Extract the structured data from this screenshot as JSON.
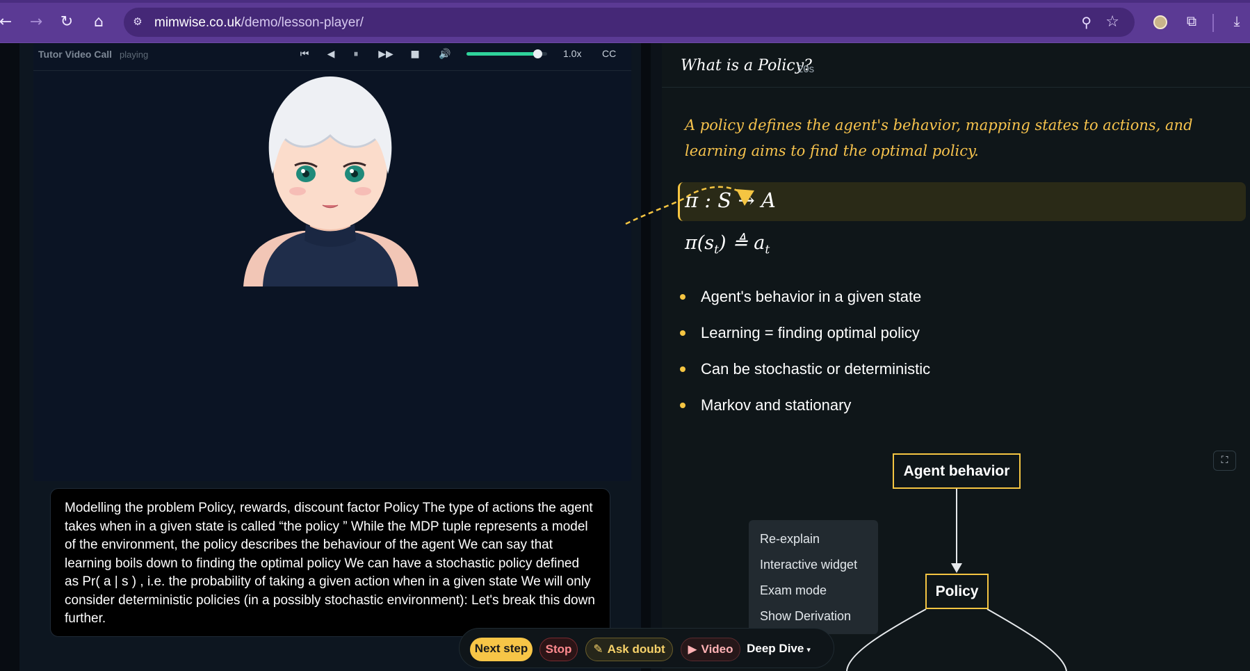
{
  "browser": {
    "url_host": "mimwise.co.uk",
    "url_path": "/demo/lesson-player/"
  },
  "video": {
    "title": "Tutor Video Call",
    "status": "playing",
    "speed": "1.0x",
    "cc_label": "CC",
    "volume_fraction": 0.88
  },
  "transcript": {
    "text": "Modelling the problem Policy, rewards, discount factor Policy The type of actions the agent takes when in a given state is called “the policy ” While the MDP tuple represents a model of the environment, the policy describes the behaviour of the agent We can say that learning boils down to finding the optimal policy We can have a stochastic policy defined as Pr( a | s ) , i.e. the probability of taking a given action when in a given state We will only consider deterministic policies (in a possibly stochastic environment): Let's break this down further."
  },
  "lesson": {
    "title": "What is a Policy?",
    "duration": "20s",
    "summary": "A policy defines the agent's behavior, mapping states to actions, and learning aims to find the optimal policy.",
    "formula1": "π : S → A",
    "formula2_lhs": "π(s",
    "formula2_sub1": "t",
    "formula2_mid": ") ≜ a",
    "formula2_sub2": "t",
    "bullets": [
      "Agent's behavior in a given state",
      "Learning = finding optimal policy",
      "Can be stochastic or deterministic",
      "Markov and stationary"
    ],
    "diagram": {
      "node_top": "Agent behavior",
      "node_bottom": "Policy"
    }
  },
  "context_menu": {
    "items": [
      "Re-explain",
      "Interactive widget",
      "Exam mode",
      "Show Derivation"
    ]
  },
  "actions": {
    "next": "Next step",
    "stop": "Stop",
    "ask": "Ask doubt",
    "video": "Video",
    "deep_dive": "Deep Dive"
  },
  "colors": {
    "accent": "#f5c542",
    "browser_chrome": "#5b3a94",
    "volume": "#2fd39b"
  }
}
